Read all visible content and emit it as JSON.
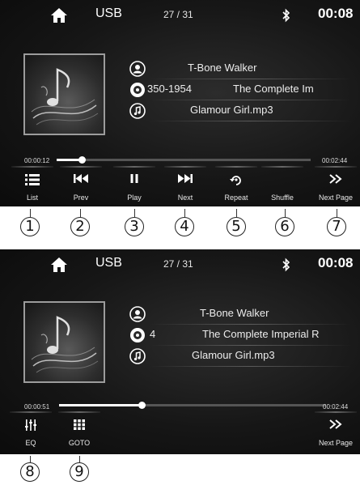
{
  "screens": [
    {
      "source": "USB",
      "track_counter": "27 / 31",
      "clock": "00:08",
      "artist": "T-Bone Walker",
      "album_prefix": "350-1954",
      "album": "The Complete Im",
      "file": "Glamour Girl.mp3",
      "elapsed": "00:00:12",
      "total": "00:02:44",
      "progress": 0.1,
      "buttons": [
        {
          "label": "List",
          "icon": "list-icon",
          "callout": "1"
        },
        {
          "label": "Prev",
          "icon": "prev-icon",
          "callout": "2"
        },
        {
          "label": "Play",
          "icon": "pause-icon",
          "callout": "3"
        },
        {
          "label": "Next",
          "icon": "next-icon",
          "callout": "4"
        },
        {
          "label": "Repeat",
          "icon": "repeat-icon",
          "callout": "5"
        },
        {
          "label": "Shuffle",
          "icon": "shuffle-icon",
          "callout": "6"
        },
        {
          "label": "Next Page",
          "icon": "next-page-icon",
          "callout": "7"
        }
      ]
    },
    {
      "source": "USB",
      "track_counter": "27 / 31",
      "clock": "00:08",
      "artist": "T-Bone Walker",
      "album_prefix": "4",
      "album": "The Complete Imperial R",
      "file": "Glamour Girl.mp3",
      "elapsed": "00:00:51",
      "total": "00:02:44",
      "progress": 0.31,
      "buttons": [
        {
          "label": "EQ",
          "icon": "eq-icon",
          "callout": "8"
        },
        {
          "label": "GOTO",
          "icon": "goto-grid-icon",
          "callout": "9"
        },
        {
          "label": "Next Page",
          "icon": "next-page-icon",
          "callout": ""
        }
      ]
    }
  ],
  "colors": {
    "screen_bg": "#161616",
    "text": "#ffffff",
    "progress_fill": "#ffffff",
    "progress_track": "#555555"
  }
}
